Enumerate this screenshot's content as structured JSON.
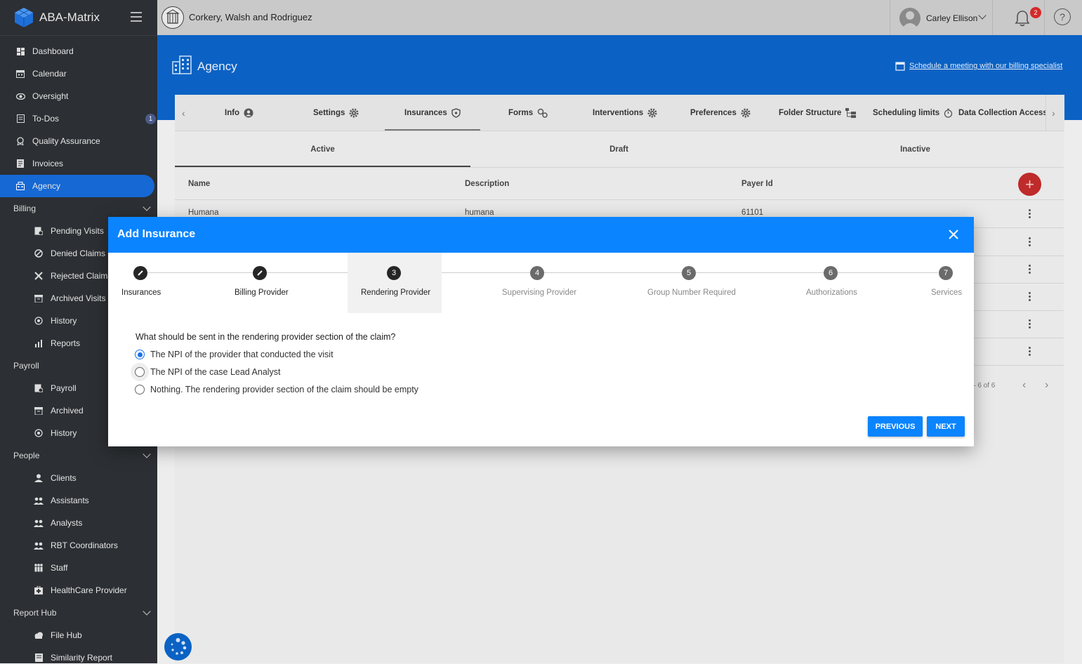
{
  "app": {
    "name": "ABA-Matrix"
  },
  "sidebar": {
    "items": [
      {
        "label": "Dashboard",
        "icon": "dashboard-icon"
      },
      {
        "label": "Calendar",
        "icon": "calendar-icon"
      },
      {
        "label": "Oversight",
        "icon": "eye-icon"
      },
      {
        "label": "To-Dos",
        "icon": "todo-icon",
        "badge": "1"
      },
      {
        "label": "Quality Assurance",
        "icon": "quality-icon"
      },
      {
        "label": "Invoices",
        "icon": "invoice-icon"
      },
      {
        "label": "Agency",
        "icon": "building-icon",
        "active": true
      }
    ],
    "billing": {
      "label": "Billing",
      "items": [
        {
          "label": "Pending Visits",
          "icon": "pending-icon"
        },
        {
          "label": "Denied Claims",
          "icon": "denied-icon"
        },
        {
          "label": "Rejected Claims",
          "icon": "rejected-icon"
        },
        {
          "label": "Archived Visits",
          "icon": "archive-icon"
        },
        {
          "label": "History",
          "icon": "history-icon"
        },
        {
          "label": "Reports",
          "icon": "reports-icon"
        }
      ]
    },
    "payroll": {
      "label": "Payroll",
      "items": [
        {
          "label": "Payroll",
          "icon": "payroll-icon"
        },
        {
          "label": "Archived",
          "icon": "archive-icon"
        },
        {
          "label": "History",
          "icon": "history-icon"
        }
      ]
    },
    "people": {
      "label": "People",
      "items": [
        {
          "label": "Clients",
          "icon": "person-icon"
        },
        {
          "label": "Assistants",
          "icon": "group-icon"
        },
        {
          "label": "Analysts",
          "icon": "group-icon"
        },
        {
          "label": "RBT Coordinators",
          "icon": "group-icon"
        },
        {
          "label": "Staff",
          "icon": "staff-icon"
        },
        {
          "label": "HealthCare Provider",
          "icon": "medical-icon"
        }
      ]
    },
    "reporthub": {
      "label": "Report Hub",
      "items": [
        {
          "label": "File Hub",
          "icon": "cloud-icon"
        },
        {
          "label": "Similarity Report",
          "icon": "report-icon"
        }
      ]
    }
  },
  "topbar": {
    "org_name": "Corkery, Walsh and Rodriguez",
    "user_name": "Carley Ellison",
    "notification_count": "2",
    "help": "?"
  },
  "header": {
    "title": "Agency",
    "schedule_link": "Schedule a meeting with our billing specialist"
  },
  "tabs": [
    {
      "label": "Info"
    },
    {
      "label": "Settings"
    },
    {
      "label": "Insurances",
      "active": true
    },
    {
      "label": "Forms"
    },
    {
      "label": "Interventions"
    },
    {
      "label": "Preferences"
    },
    {
      "label": "Folder Structure"
    },
    {
      "label": "Scheduling limits"
    },
    {
      "label": "Data Collection Access"
    }
  ],
  "subtabs": [
    {
      "label": "Active",
      "active": true
    },
    {
      "label": "Draft"
    },
    {
      "label": "Inactive"
    }
  ],
  "table": {
    "headers": [
      "Name",
      "Description",
      "Payer Id"
    ],
    "rows": [
      {
        "name": "Humana",
        "description": "humana",
        "payer_id": "61101"
      }
    ],
    "pagination": "– 6 of 6"
  },
  "dialog": {
    "title": "Add Insurance",
    "steps": [
      {
        "label": "Insurances",
        "marker": "edit-icon",
        "state": "done"
      },
      {
        "label": "Billing Provider",
        "marker": "edit-icon",
        "state": "done"
      },
      {
        "label": "Rendering Provider",
        "number": "3",
        "state": "current"
      },
      {
        "label": "Supervising Provider",
        "number": "4",
        "state": "pending"
      },
      {
        "label": "Group Number Required",
        "number": "5",
        "state": "pending"
      },
      {
        "label": "Authorizations",
        "number": "6",
        "state": "pending"
      },
      {
        "label": "Services",
        "number": "7",
        "state": "pending"
      }
    ],
    "question": "What should be sent in the rendering provider section of the claim?",
    "options": [
      {
        "label": "The NPI of the provider that conducted the visit",
        "checked": true
      },
      {
        "label": "The NPI of the case Lead Analyst",
        "checked": false
      },
      {
        "label": "Nothing. The rendering provider section of the claim should be empty",
        "checked": false
      }
    ],
    "buttons": {
      "previous": "PREVIOUS",
      "next": "NEXT"
    }
  },
  "colors": {
    "sidebar": "#2c2f33",
    "primary": "#0b62c4",
    "dialog_accent": "#0a84ff",
    "fab": "#bf2a2a"
  }
}
